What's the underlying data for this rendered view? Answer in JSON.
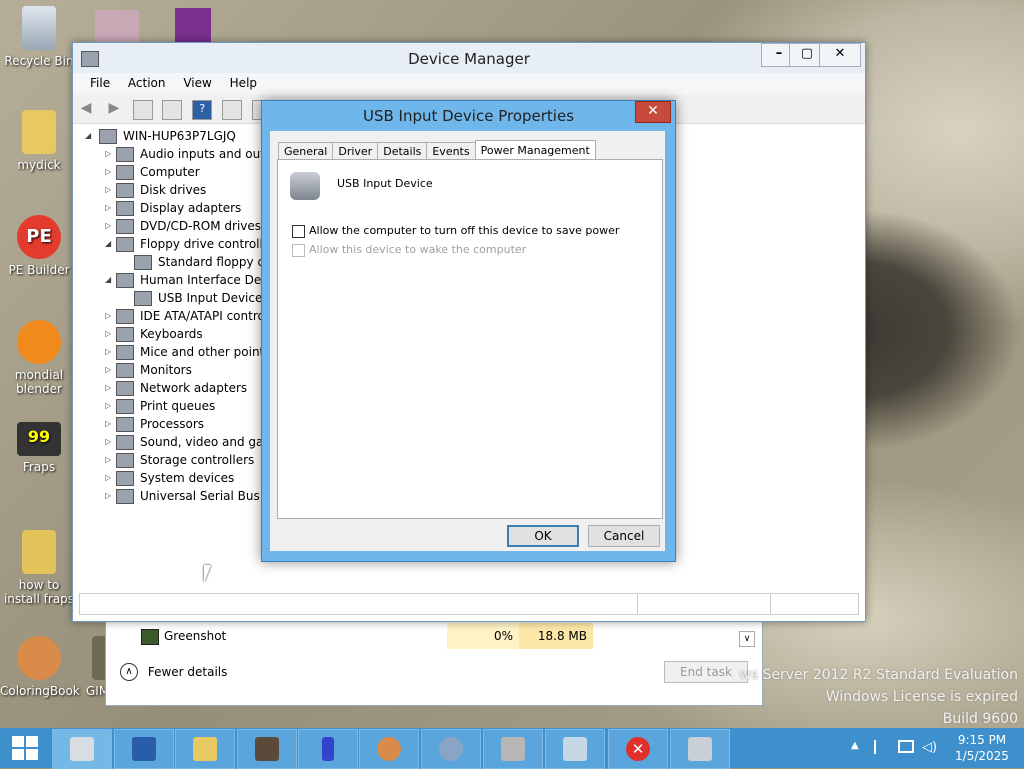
{
  "desktop": {
    "icons": [
      {
        "label": "Recycle Bin"
      },
      {
        "label": "mydick"
      },
      {
        "label": "PE Builder"
      },
      {
        "label": "mondial blender"
      },
      {
        "label": "Fraps"
      },
      {
        "label": "how to install fraps"
      },
      {
        "label": "ColoringBook"
      },
      {
        "label": "GIM"
      }
    ],
    "watermark": {
      "line1": "ws Server 2012 R2 Standard Evaluation",
      "line2": "Windows License is expired",
      "line3": "Build 9600"
    }
  },
  "device_manager": {
    "title": "Device Manager",
    "menu": [
      "File",
      "Action",
      "View",
      "Help"
    ],
    "root": "WIN-HUP63P7LGJQ",
    "tree": [
      {
        "label": "Audio inputs and outp",
        "exp": "▷",
        "indent": 0
      },
      {
        "label": "Computer",
        "exp": "▷",
        "indent": 0
      },
      {
        "label": "Disk drives",
        "exp": "▷",
        "indent": 0
      },
      {
        "label": "Display adapters",
        "exp": "▷",
        "indent": 0
      },
      {
        "label": "DVD/CD-ROM drives",
        "exp": "▷",
        "indent": 0
      },
      {
        "label": "Floppy drive controller",
        "exp": "◢",
        "indent": 0
      },
      {
        "label": "Standard floppy dis",
        "exp": "",
        "indent": 1
      },
      {
        "label": "Human Interface Devic",
        "exp": "◢",
        "indent": 0
      },
      {
        "label": "USB Input Device",
        "exp": "",
        "indent": 1
      },
      {
        "label": "IDE ATA/ATAPI contro",
        "exp": "▷",
        "indent": 0
      },
      {
        "label": "Keyboards",
        "exp": "▷",
        "indent": 0
      },
      {
        "label": "Mice and other pointin",
        "exp": "▷",
        "indent": 0
      },
      {
        "label": "Monitors",
        "exp": "▷",
        "indent": 0
      },
      {
        "label": "Network adapters",
        "exp": "▷",
        "indent": 0
      },
      {
        "label": "Print queues",
        "exp": "▷",
        "indent": 0
      },
      {
        "label": "Processors",
        "exp": "▷",
        "indent": 0
      },
      {
        "label": "Sound, video and gam",
        "exp": "▷",
        "indent": 0
      },
      {
        "label": "Storage controllers",
        "exp": "▷",
        "indent": 0
      },
      {
        "label": "System devices",
        "exp": "▷",
        "indent": 0
      },
      {
        "label": "Universal Serial Bus co",
        "exp": "▷",
        "indent": 0
      }
    ]
  },
  "dialog": {
    "title": "USB Input Device Properties",
    "close": "✕",
    "tabs": [
      "General",
      "Driver",
      "Details",
      "Events",
      "Power Management"
    ],
    "device_name": "USB Input Device",
    "option1": "Allow the computer to turn off this device to save power",
    "option2": "Allow this device to wake the computer",
    "ok": "OK",
    "cancel": "Cancel"
  },
  "task_manager": {
    "process": "Greenshot",
    "cpu": "0%",
    "memory": "18.8 MB",
    "fewer_details": "Fewer details",
    "end_task": "End task"
  },
  "taskbar": {
    "time": "9:15 PM",
    "date": "1/5/2025",
    "accent": "#3e90cd"
  }
}
